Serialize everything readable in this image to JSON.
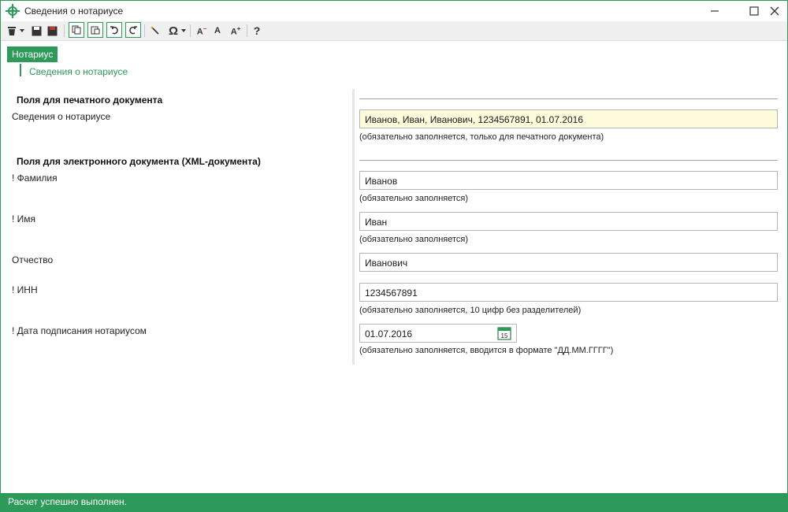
{
  "window": {
    "title": "Сведения о нотариусе",
    "accent_color": "#2e9a5a"
  },
  "controls": {
    "minimize_icon": "minimize-icon",
    "maximize_icon": "maximize-icon",
    "close_icon": "close-icon"
  },
  "toolbar": {
    "items": [
      "delete-icon",
      "dropdown-icon",
      "save-icon",
      "save-all-icon",
      "copy-icon",
      "paste-icon",
      "undo-icon",
      "redo-icon",
      "wand-icon",
      "omega-icon",
      "font-decrease-icon",
      "font-normal-icon",
      "font-increase-icon",
      "help-icon"
    ],
    "help_label": "?"
  },
  "nav": {
    "tab_label": "Нотариус",
    "sub_link": "Сведения о нотариусе"
  },
  "print_section": {
    "title": "Поля для печатного документа",
    "label": "Сведения о нотариусе",
    "value": "Иванов, Иван, Иванович, 1234567891, 01.07.2016",
    "hint": "(обязательно заполняется, только для печатного документа)"
  },
  "xml_section": {
    "title": "Поля для электронного документа (XML-документа)",
    "surname_label": "! Фамилия",
    "surname_value": "Иванов",
    "surname_hint": "(обязательно заполняется)",
    "name_label": "! Имя",
    "name_value": "Иван",
    "name_hint": "(обязательно заполняется)",
    "patronymic_label": "Отчество",
    "patronymic_value": "Иванович",
    "inn_label": "! ИНН",
    "inn_value": "1234567891",
    "inn_hint": "(обязательно заполняется, 10 цифр без разделителей)",
    "date_label": "! Дата подписания нотариусом",
    "date_value": "01.07.2016",
    "date_hint": "(обязательно заполняется, вводится в формате \"ДД.ММ.ГГГГ\")",
    "calendar_day": "15"
  },
  "status": {
    "text": "Расчет успешно выполнен."
  }
}
